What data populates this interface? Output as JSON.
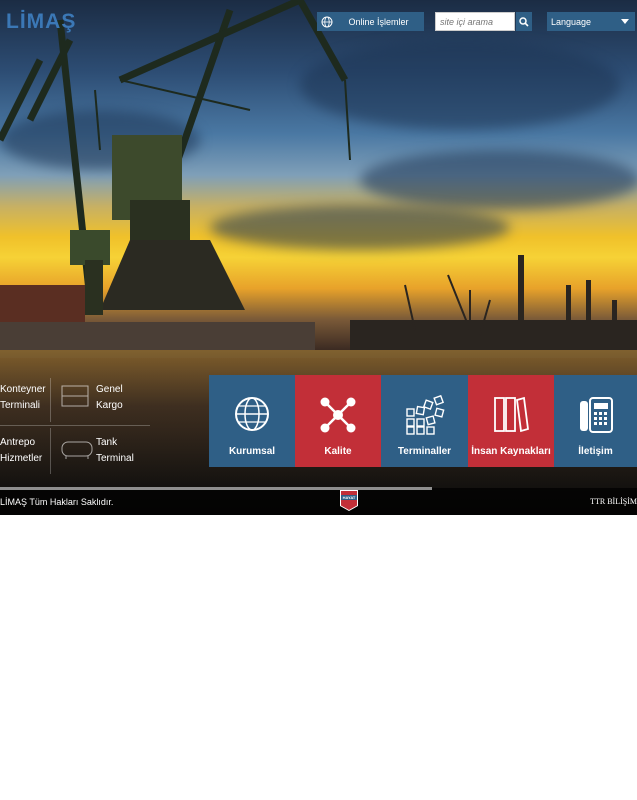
{
  "header": {
    "logo": "LİMAŞ",
    "online_label": "Online İşlemler",
    "search_placeholder": "site içi arama",
    "language_label": "Language"
  },
  "side_links": [
    {
      "line1": "Konteyner",
      "line2": "Terminali"
    },
    {
      "line1": "Genel",
      "line2": "Kargo"
    },
    {
      "line1": "Antrepo",
      "line2": "Hizmetler"
    },
    {
      "line1": "Tank",
      "line2": "Terminal"
    }
  ],
  "tiles": [
    {
      "label": "Kurumsal",
      "color": "#2f5f86",
      "icon": "globe-icon"
    },
    {
      "label": "Kalite",
      "color": "#c22f38",
      "icon": "network-icon"
    },
    {
      "label": "Terminaller",
      "color": "#2f5f86",
      "icon": "blocks-icon"
    },
    {
      "label": "İnsan Kaynakları",
      "color": "#c22f38",
      "icon": "books-icon"
    },
    {
      "label": "İletişim",
      "color": "#2f5f86",
      "icon": "phone-icon"
    }
  ],
  "footer": {
    "copyright": "LİMAŞ Tüm Hakları Saklıdır.",
    "badge": "HAYAT",
    "credit": "TTR BİLİŞİM"
  }
}
